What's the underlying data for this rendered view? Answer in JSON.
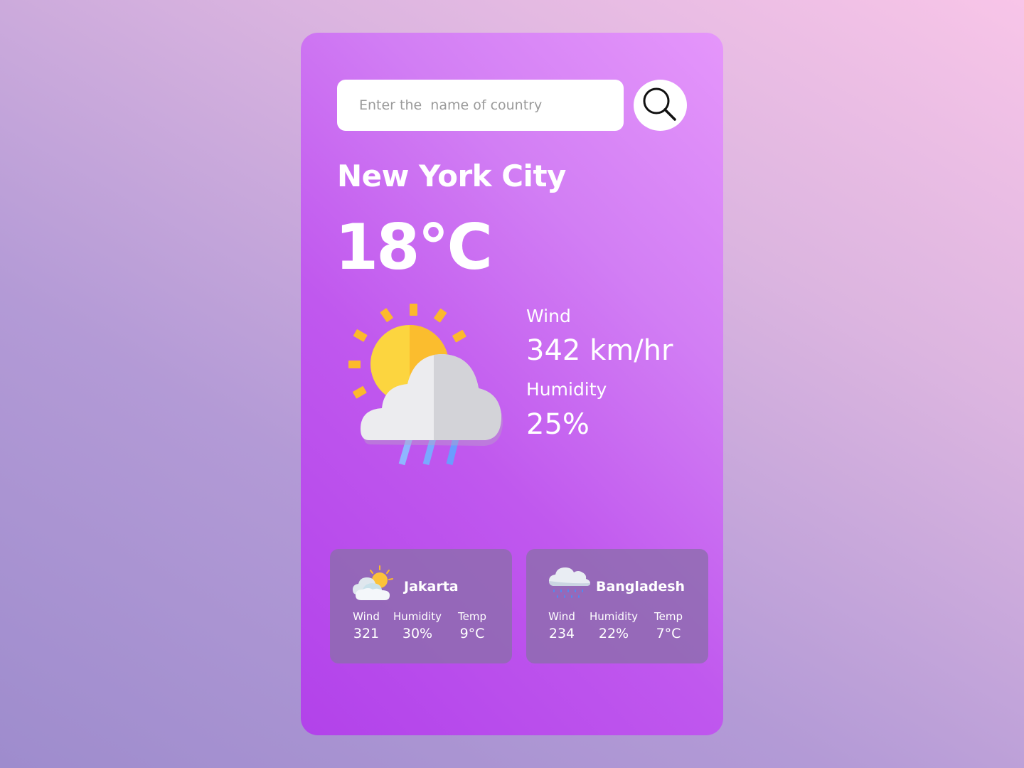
{
  "search": {
    "placeholder": "Enter the  name of country",
    "button_icon": "search-icon"
  },
  "current": {
    "city": "New York City",
    "temperature": "18°C",
    "icon": "sun-cloud-rain-icon",
    "wind_label": "Wind",
    "wind_value": "342 km/hr",
    "humidity_label": "Humidity",
    "humidity_value": "25%"
  },
  "others": [
    {
      "city": "Jakarta",
      "icon": "partly-cloudy-icon",
      "wind_label": "Wind",
      "wind_value": "321",
      "humidity_label": "Humidity",
      "humidity_value": "30%",
      "temp_label": "Temp",
      "temp_value": "9°C"
    },
    {
      "city": "Bangladesh",
      "icon": "rain-cloud-icon",
      "wind_label": "Wind",
      "wind_value": "234",
      "humidity_label": "Humidity",
      "humidity_value": "22%",
      "temp_label": "Temp",
      "temp_value": "7°C"
    }
  ],
  "colors": {
    "card_gradient_start": "#e596fb",
    "card_gradient_end": "#b242ea",
    "sun": "#fcd53f",
    "cloud": "#e8e8ec",
    "rain": "#7aa9ff"
  }
}
